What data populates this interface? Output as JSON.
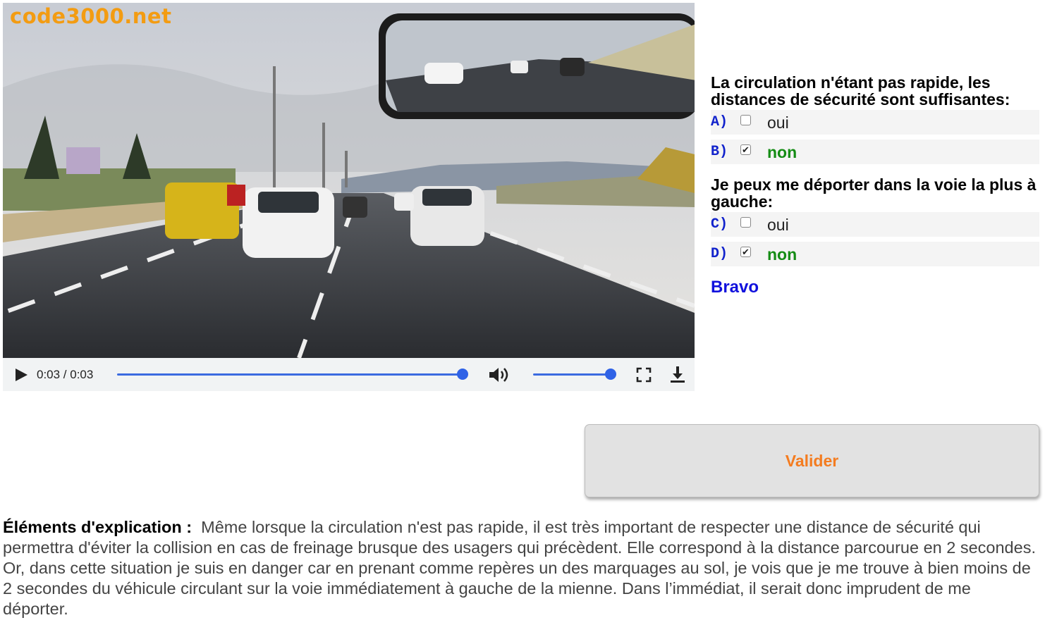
{
  "brand": "code3000.net",
  "player": {
    "time": "0:03 / 0:03",
    "progress": 1.0,
    "volume": 1.0
  },
  "questions": [
    {
      "text": "La circulation n'étant pas rapide, les distances de sécurité sont suffisantes:",
      "options": [
        {
          "letter": "A)",
          "label": "oui",
          "checked": false
        },
        {
          "letter": "B)",
          "label": "non",
          "checked": true
        }
      ]
    },
    {
      "text": "Je peux me déporter dans la voie la plus à gauche:",
      "options": [
        {
          "letter": "C)",
          "label": "oui",
          "checked": false
        },
        {
          "letter": "D)",
          "label": "non",
          "checked": true
        }
      ]
    }
  ],
  "feedback": "Bravo",
  "submit_label": "Valider",
  "explanation": {
    "heading": "Éléments d'explication :",
    "body": "Même lorsque la circulation n'est pas rapide, il est très important de respecter une distance de sécurité qui permettra d'éviter la collision en cas de freinage brusque des usagers qui précèdent. Elle correspond à la distance parcourue en 2 secondes. Or, dans cette situation je suis en danger car en prenant comme repères un des marquages au sol, je vois que je me trouve à bien moins de 2 secondes du véhicule circulant sur la voie immédiatement à gauche de la mienne. Dans l’immédiat, il serait donc imprudent de me déporter."
  },
  "colors": {
    "accent": "#2f62e6",
    "brand": "#f39c12",
    "correct": "#148c14",
    "letters": "#1122cc",
    "submit": "#f47c20"
  },
  "icons": [
    "play-icon",
    "volume-icon",
    "fullscreen-icon",
    "download-icon"
  ]
}
